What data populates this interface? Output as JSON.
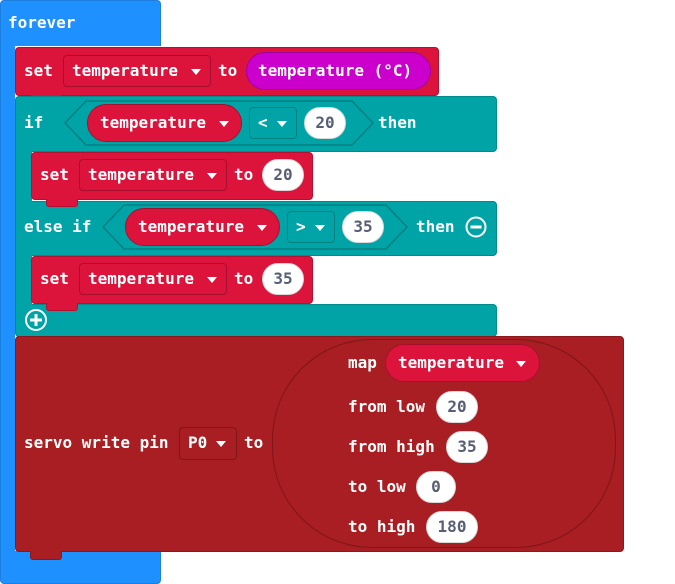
{
  "forever": {
    "label": "forever"
  },
  "set_block_1": {
    "keyword": "set",
    "variable": "temperature",
    "to": "to",
    "value": "temperature (°C)"
  },
  "if_block": {
    "if": "if",
    "condition": {
      "variable": "temperature",
      "operator": "<",
      "value": "20"
    },
    "then": "then",
    "set": {
      "keyword": "set",
      "variable": "temperature",
      "to": "to",
      "value": "20"
    }
  },
  "elseif_block": {
    "else_if": "else if",
    "condition": {
      "variable": "temperature",
      "operator": ">",
      "value": "35"
    },
    "then": "then",
    "set": {
      "keyword": "set",
      "variable": "temperature",
      "to": "to",
      "value": "35"
    }
  },
  "servo_block": {
    "label": "servo write pin",
    "pin": "P0",
    "to": "to",
    "map": {
      "label": "map",
      "variable": "temperature",
      "from_low_label": "from low",
      "from_low": "20",
      "from_high_label": "from high",
      "from_high": "35",
      "to_low_label": "to low",
      "to_low": "0",
      "to_high_label": "to high",
      "to_high": "180"
    }
  },
  "colors": {
    "loops": "#1E90FF",
    "variables": "#DC143C",
    "logic": "#00A4A6",
    "servo": "#A91E22",
    "input": "#CC00CC"
  }
}
